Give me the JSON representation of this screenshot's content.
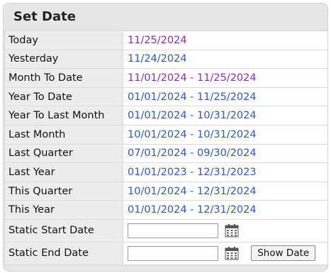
{
  "title": "Set Date",
  "presets": [
    {
      "label": "Today",
      "value": "11/25/2024",
      "visited": true
    },
    {
      "label": "Yesterday",
      "value": "11/24/2024",
      "visited": false
    },
    {
      "label": "Month To Date",
      "value": "11/01/2024 - 11/25/2024",
      "visited": true
    },
    {
      "label": "Year To Date",
      "value": "01/01/2024 - 11/25/2024",
      "visited": false
    },
    {
      "label": "Year To Last Month",
      "value": "01/01/2024 - 10/31/2024",
      "visited": false
    },
    {
      "label": "Last Month",
      "value": "10/01/2024 - 10/31/2024",
      "visited": false
    },
    {
      "label": "Last Quarter",
      "value": "07/01/2024 - 09/30/2024",
      "visited": false
    },
    {
      "label": "Last Year",
      "value": "01/01/2023 - 12/31/2023",
      "visited": false
    },
    {
      "label": "This Quarter",
      "value": "10/01/2024 - 12/31/2024",
      "visited": false
    },
    {
      "label": "This Year",
      "value": "01/01/2024 - 12/31/2024",
      "visited": false
    }
  ],
  "static_start": {
    "label": "Static Start Date",
    "value": "",
    "icon": "calendar-icon"
  },
  "static_end": {
    "label": "Static End Date",
    "value": "",
    "icon": "calendar-icon"
  },
  "show_button": "Show Date",
  "colors": {
    "link": "#2f58c9",
    "visited_link": "#8a2fb5"
  }
}
